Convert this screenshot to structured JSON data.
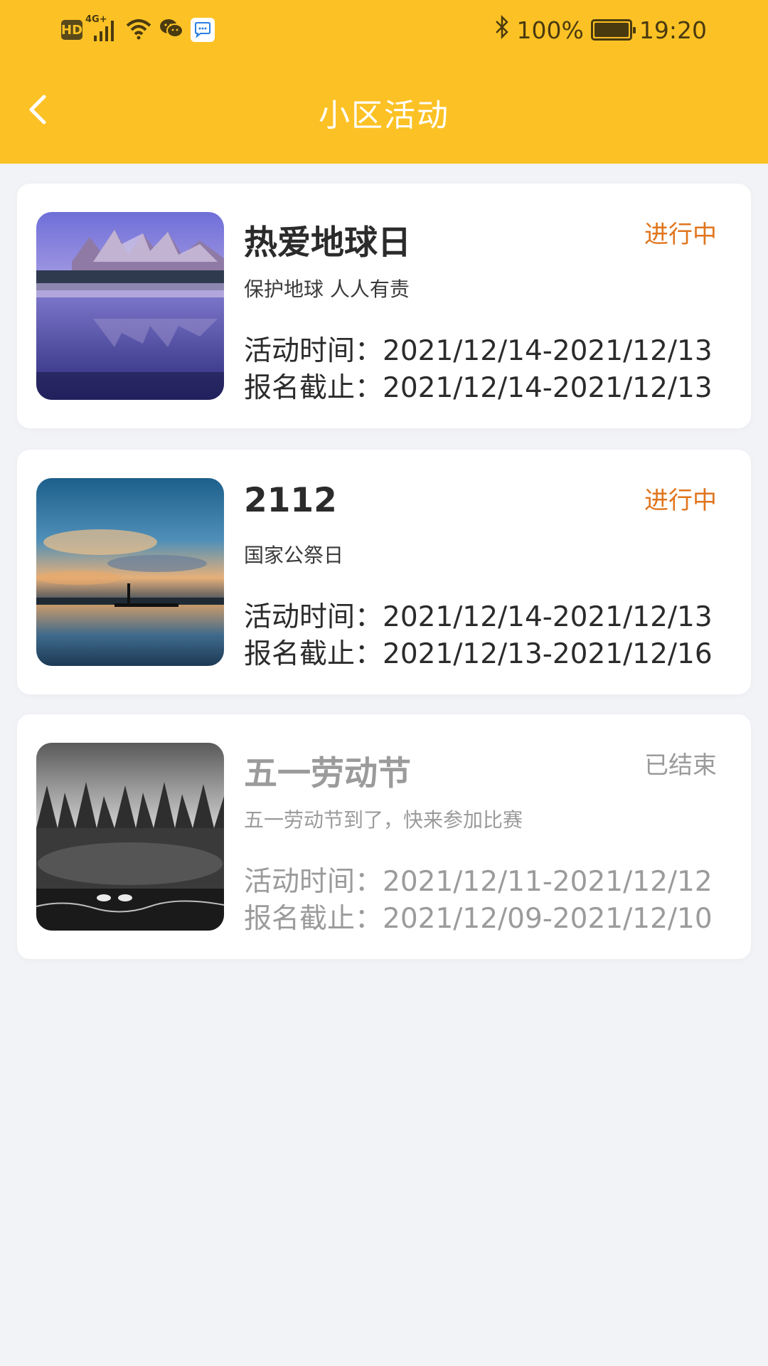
{
  "status_bar": {
    "network_badge": "HD",
    "network_type": "4G+",
    "battery": "100%",
    "battery_level": 1.0,
    "time": "19:20",
    "icons": [
      "hd-icon",
      "signal-icon",
      "wifi-icon",
      "wechat-icon",
      "chat-app-icon",
      "bluetooth-icon",
      "battery-icon"
    ]
  },
  "nav": {
    "title": "小区活动",
    "back_icon": "chevron-left-icon"
  },
  "colors": {
    "header": "#fcc225",
    "status_ongoing": "#e0751c",
    "status_ended": "#9b9b9b"
  },
  "activities": [
    {
      "title": "热爱地球日",
      "status": "进行中",
      "subtitle": "保护地球 人人有责",
      "time_label": "活动时间：",
      "time_value": "2021/12/14-2021/12/13",
      "deadline_label": "报名截止：",
      "deadline_value": "2021/12/14-2021/12/13"
    },
    {
      "title": "2112",
      "status": "进行中",
      "subtitle": "国家公祭日",
      "time_label": "活动时间：",
      "time_value": "2021/12/14-2021/12/13",
      "deadline_label": "报名截止：",
      "deadline_value": "2021/12/13-2021/12/16"
    },
    {
      "title": "五一劳动节",
      "status": "已结束",
      "subtitle": "五一劳动节到了，快来参加比赛",
      "time_label": "活动时间：",
      "time_value": "2021/12/11-2021/12/12",
      "deadline_label": "报名截止：",
      "deadline_value": "2021/12/09-2021/12/10"
    }
  ]
}
